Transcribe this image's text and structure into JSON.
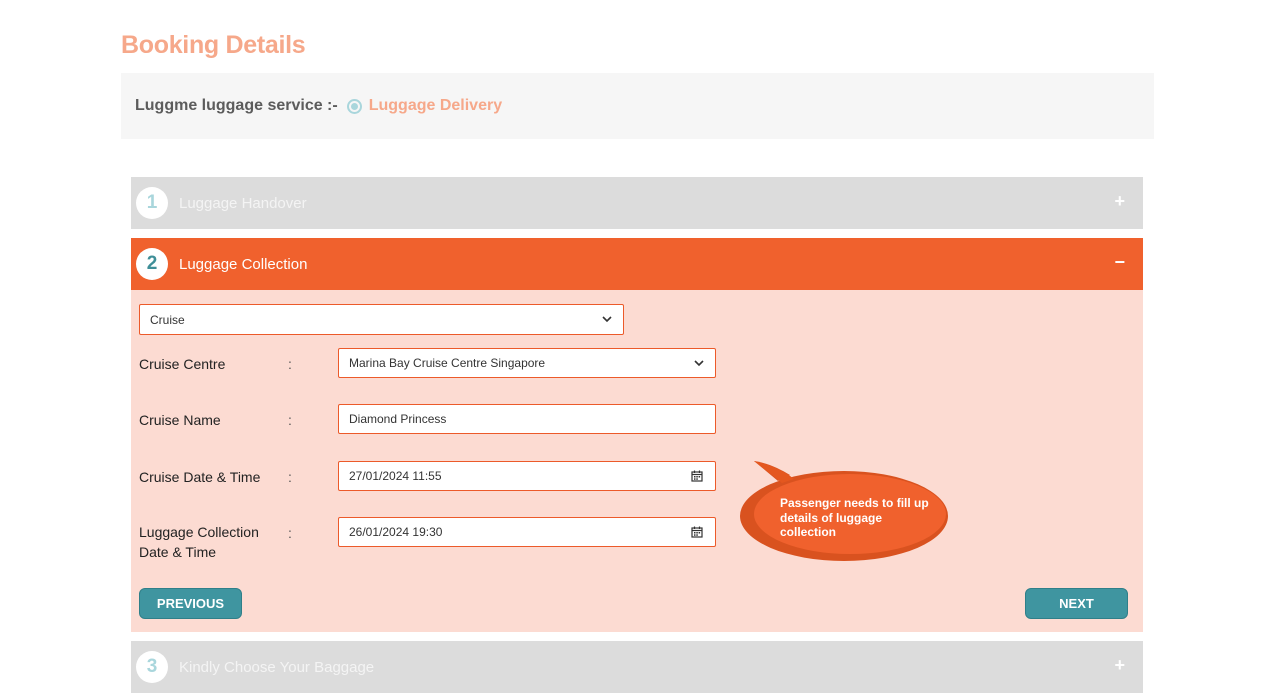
{
  "page": {
    "title": "Booking Details"
  },
  "service": {
    "label": "Luggme luggage service :-",
    "option": "Luggage Delivery"
  },
  "steps": [
    {
      "number": "1",
      "title": "Luggage Handover",
      "toggle": "+"
    },
    {
      "number": "2",
      "title": "Luggage Collection",
      "toggle": "−"
    },
    {
      "number": "3",
      "title": "Kindly Choose Your Baggage",
      "toggle": "+"
    }
  ],
  "collection": {
    "type_select": "Cruise",
    "fields": {
      "cruise_centre": {
        "label": "Cruise Centre",
        "value": "Marina Bay Cruise Centre Singapore"
      },
      "cruise_name": {
        "label": "Cruise Name",
        "value": "Diamond Princess"
      },
      "cruise_datetime": {
        "label": "Cruise Date & Time",
        "value": "27/01/2024 11:55"
      },
      "collection_datetime": {
        "label_line1": "Luggage Collection",
        "label_line2": "Date & Time",
        "value": "26/01/2024 19:30"
      }
    },
    "colon": ":",
    "previous_label": "PREVIOUS",
    "next_label": "NEXT"
  },
  "tooltip": {
    "text": "Passenger needs to fill up details of luggage collection"
  },
  "colors": {
    "accent": "#f0612d",
    "title": "#f6a88a",
    "button": "#3f95a0",
    "panel": "#fcdbd2"
  }
}
